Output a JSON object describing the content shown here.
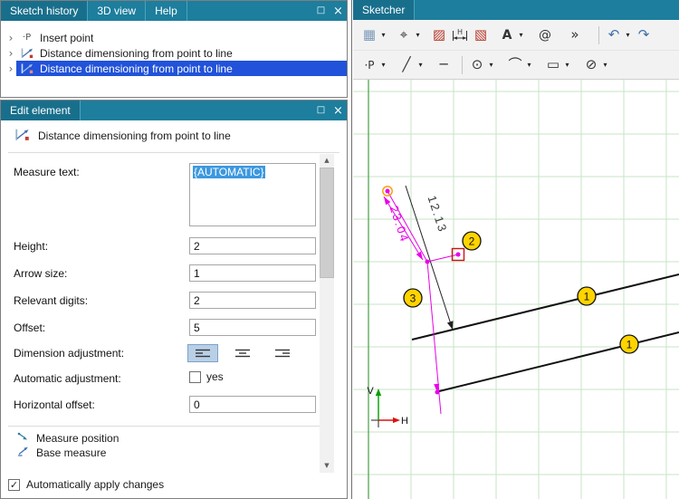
{
  "icons": {
    "maximize": "□",
    "close": "×",
    "chevron": "›",
    "dropdown": "▾",
    "check": "✓",
    "scroll_up": "▲",
    "scroll_down": "▼",
    "sheet": "▦",
    "select": "⌖",
    "hatch": "▨",
    "dim_box": "▧",
    "dim_h": "H",
    "text": "A",
    "at": "@",
    "overflow": "»",
    "undo": "↶",
    "redo": "↷",
    "point": "·P",
    "line": "╱",
    "hline": "─",
    "circle": "⊙",
    "arc": "⌒",
    "rect": "▭",
    "ellipse": "⊘"
  },
  "sketch_history": {
    "tabs": [
      {
        "label": "Sketch history"
      },
      {
        "label": "3D view"
      },
      {
        "label": "Help"
      }
    ],
    "items": [
      {
        "label": "Insert point"
      },
      {
        "label": "Distance dimensioning from point to line"
      },
      {
        "label": "Distance dimensioning from point to line"
      }
    ]
  },
  "edit_element": {
    "tab": "Edit element",
    "header": "Distance dimensioning from point to line",
    "measure_text": {
      "label": "Measure text:",
      "value": "{AUTOMATIC}"
    },
    "height": {
      "label": "Height:",
      "value": "2"
    },
    "arrow_size": {
      "label": "Arrow size:",
      "value": "1"
    },
    "relevant_digits": {
      "label": "Relevant digits:",
      "value": "2"
    },
    "offset": {
      "label": "Offset:",
      "value": "5"
    },
    "dimension_adjustment": {
      "label": "Dimension adjustment:"
    },
    "automatic_adjustment": {
      "label": "Automatic adjustment:",
      "option": "yes"
    },
    "horizontal_offset": {
      "label": "Horizontal offset:",
      "value": "0"
    },
    "legend": [
      {
        "label": "Measure position"
      },
      {
        "label": "Base measure"
      }
    ],
    "apply": {
      "label": "Automatically apply changes"
    }
  },
  "sketcher": {
    "tab": "Sketcher",
    "canvas": {
      "dim_black": "12.13",
      "dim_magenta": "23.04",
      "markers": {
        "line_top": "1",
        "line_bottom": "1",
        "point": "2",
        "base": "3"
      },
      "axes": {
        "v": "V",
        "h": "H"
      }
    }
  }
}
